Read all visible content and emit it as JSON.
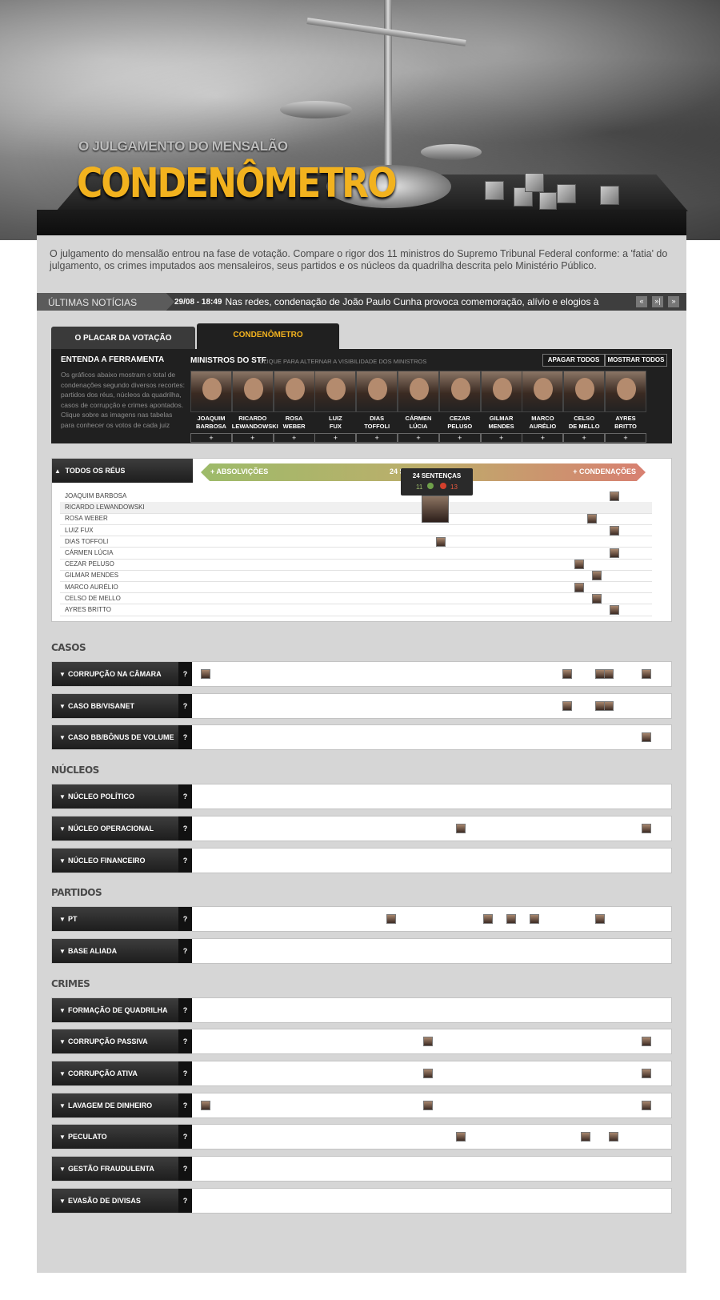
{
  "header": {
    "subtitle": "O JULGAMENTO DO MENSALÃO",
    "title": "CONDENÔMETRO"
  },
  "intro": "O julgamento do mensalão entrou na fase de votação. Compare o rigor dos 11 ministros do Supremo Tribunal Federal conforme: a 'fatia' do julgamento, os crimes imputados aos mensaleiros, seus partidos e os núcleos da quadrilha descrita pelo Ministério Público.",
  "news": {
    "label": "ÚLTIMAS NOTÍCIAS",
    "date": "29/08 - 18:49",
    "text": "Nas redes, condenação de João Paulo Cunha provoca comemoração, alívio e elogios à",
    "prev_icon": "double-chevron-left-icon",
    "next_icon": "double-chevron-right-icon"
  },
  "tabs": [
    {
      "label": "O PLACAR DA VOTAÇÃO"
    },
    {
      "label": "CONDENÔMETRO"
    }
  ],
  "tool": {
    "help_title": "ENTENDA A FERRAMENTA",
    "help_text": "Os gráficos abaixo mostram o total de condenações segundo diversos recortes: partidos dos réus, núcleos da quadrilha, casos de corrupção e crimes apontados. Clique sobre as imagens nas tabelas para conhecer os votos de cada juiz",
    "ministers_title": "MINISTROS DO STF",
    "ministers_hint": "CLIQUE PARA ALTERNAR A VISIBILIDADE DOS MINISTROS",
    "clear_all": "APAGAR TODOS",
    "show_all": "MOSTRAR TODOS",
    "plus": "+",
    "ministers": [
      {
        "l1": "JOAQUIM",
        "l2": "BARBOSA"
      },
      {
        "l1": "RICARDO",
        "l2": "LEWANDOWSKI"
      },
      {
        "l1": "ROSA",
        "l2": "WEBER"
      },
      {
        "l1": "LUIZ",
        "l2": "FUX"
      },
      {
        "l1": "DIAS",
        "l2": "TOFFOLI"
      },
      {
        "l1": "CÁRMEN",
        "l2": "LÚCIA"
      },
      {
        "l1": "CEZAR",
        "l2": "PELUSO"
      },
      {
        "l1": "GILMAR",
        "l2": "MENDES"
      },
      {
        "l1": "MARCO",
        "l2": "AURÉLIO"
      },
      {
        "l1": "CELSO",
        "l2": "DE MELLO"
      },
      {
        "l1": "AYRES",
        "l2": "BRITTO"
      }
    ]
  },
  "todos": {
    "label": "TODOS OS RÉUS",
    "absolvicoes": "+ ABSOLVIÇÕES",
    "center": "24 SE",
    "condenacoes": "+ CONDENAÇÕES",
    "tooltip": {
      "title": "24 SENTENÇAS",
      "absolvicoes": "11",
      "condenacoes": "13"
    },
    "rows": [
      {
        "name": "JOAQUIM BARBOSA",
        "pos": 0.93
      },
      {
        "name": "RICARDO LEWANDOWSKI",
        "pos": 0.5
      },
      {
        "name": "ROSA WEBER",
        "pos": 0.88
      },
      {
        "name": "LUIZ FUX",
        "pos": 0.93
      },
      {
        "name": "DIAS TOFFOLI",
        "pos": 0.54
      },
      {
        "name": "CÁRMEN LÚCIA",
        "pos": 0.93
      },
      {
        "name": "CEZAR PELUSO",
        "pos": 0.85
      },
      {
        "name": "GILMAR MENDES",
        "pos": 0.89
      },
      {
        "name": "MARCO AURÉLIO",
        "pos": 0.85
      },
      {
        "name": "CELSO DE MELLO",
        "pos": 0.89
      },
      {
        "name": "AYRES BRITTO",
        "pos": 0.93
      }
    ]
  },
  "sections": [
    {
      "title": "CASOS",
      "items": [
        {
          "label": "CORRUPÇÃO NA CÂMARA",
          "dots": [
            0.02,
            0.8,
            0.87,
            0.89,
            0.97
          ]
        },
        {
          "label": "CASO BB/VISANET",
          "dots": [
            0.8,
            0.87,
            0.89
          ]
        },
        {
          "label": "CASO BB/BÔNUS DE VOLUME",
          "dots": [
            0.97
          ]
        }
      ]
    },
    {
      "title": "NÚCLEOS",
      "items": [
        {
          "label": "NÚCLEO POLÍTICO",
          "dots": []
        },
        {
          "label": "NÚCLEO OPERACIONAL",
          "dots": [
            0.57,
            0.97
          ]
        },
        {
          "label": "NÚCLEO FINANCEIRO",
          "dots": []
        }
      ]
    },
    {
      "title": "PARTIDOS",
      "items": [
        {
          "label": "PT",
          "dots": [
            0.42,
            0.63,
            0.68,
            0.73,
            0.87
          ]
        },
        {
          "label": "BASE ALIADA",
          "dots": []
        }
      ]
    },
    {
      "title": "CRIMES",
      "items": [
        {
          "label": "FORMAÇÃO DE QUADRILHA",
          "dots": []
        },
        {
          "label": "CORRUPÇÃO PASSIVA",
          "dots": [
            0.5,
            0.97
          ]
        },
        {
          "label": "CORRUPÇÃO ATIVA",
          "dots": [
            0.5,
            0.97
          ]
        },
        {
          "label": "LAVAGEM DE DINHEIRO",
          "dots": [
            0.02,
            0.5,
            0.97
          ]
        },
        {
          "label": "PECULATO",
          "dots": [
            0.57,
            0.84,
            0.9
          ]
        },
        {
          "label": "GESTÃO FRAUDULENTA",
          "dots": []
        },
        {
          "label": "EVASÃO DE DIVISAS",
          "dots": []
        }
      ]
    }
  ],
  "help_label": "?",
  "colors": {
    "accent": "#f2b21e",
    "absolvicao": "#9dbb6a",
    "condenacao": "#d88071"
  }
}
